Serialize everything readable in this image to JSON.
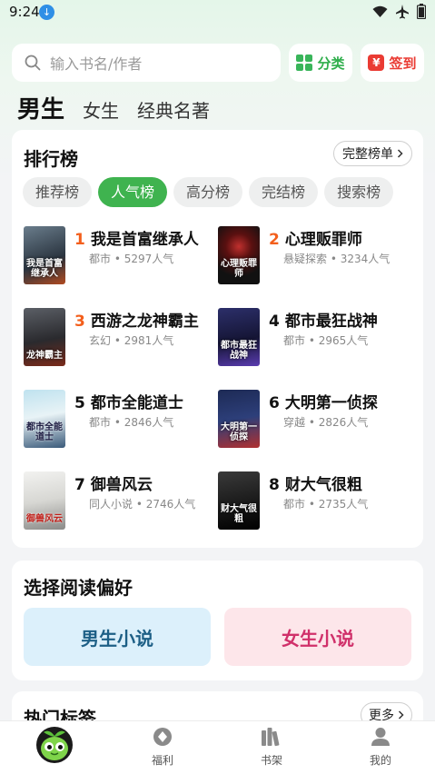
{
  "status_bar": {
    "time": "9:24"
  },
  "search": {
    "placeholder": "输入书名/作者"
  },
  "top_buttons": {
    "category": "分类",
    "checkin": "签到"
  },
  "gender_tabs": [
    {
      "label": "男生",
      "active": true
    },
    {
      "label": "女生",
      "active": false
    },
    {
      "label": "经典名著",
      "active": false
    }
  ],
  "ranking": {
    "title": "排行榜",
    "full_list": "完整榜单",
    "tabs": [
      {
        "label": "推荐榜",
        "active": false
      },
      {
        "label": "人气榜",
        "active": true
      },
      {
        "label": "高分榜",
        "active": false
      },
      {
        "label": "完结榜",
        "active": false
      },
      {
        "label": "搜索榜",
        "active": false
      }
    ],
    "books": [
      {
        "rank": "1",
        "title": "我是首富继承人",
        "genre": "都市",
        "popularity": "5297人气",
        "cover_text": "我是首富继承人"
      },
      {
        "rank": "2",
        "title": "心理贩罪师",
        "genre": "悬疑探索",
        "popularity": "3234人气",
        "cover_text": "心理贩罪师"
      },
      {
        "rank": "3",
        "title": "西游之龙神霸主",
        "genre": "玄幻",
        "popularity": "2981人气",
        "cover_text": "龙神霸主"
      },
      {
        "rank": "4",
        "title": "都市最狂战神",
        "genre": "都市",
        "popularity": "2965人气",
        "cover_text": "都市最狂战神"
      },
      {
        "rank": "5",
        "title": "都市全能道士",
        "genre": "都市",
        "popularity": "2846人气",
        "cover_text": "都市全能道士"
      },
      {
        "rank": "6",
        "title": "大明第一侦探",
        "genre": "穿越",
        "popularity": "2826人气",
        "cover_text": "大明第一侦探"
      },
      {
        "rank": "7",
        "title": "御兽风云",
        "genre": "同人小说",
        "popularity": "2746人气",
        "cover_text": "御兽风云"
      },
      {
        "rank": "8",
        "title": "财大气很粗",
        "genre": "都市",
        "popularity": "2735人气",
        "cover_text": "财大气很粗"
      }
    ],
    "meta_separator": "•"
  },
  "preference": {
    "title": "选择阅读偏好",
    "male": "男生小说",
    "female": "女生小说"
  },
  "hot_tags": {
    "title": "热门标签",
    "more": "更多"
  },
  "bottom_nav": [
    {
      "label": "",
      "icon": "app-mascot-icon"
    },
    {
      "label": "福利",
      "icon": "welfare-icon"
    },
    {
      "label": "书架",
      "icon": "bookshelf-icon"
    },
    {
      "label": "我的",
      "icon": "profile-icon"
    }
  ],
  "colors": {
    "accent": "#3fb34f",
    "rank_highlight": "#f35f1c",
    "checkin": "#ea3b33"
  }
}
